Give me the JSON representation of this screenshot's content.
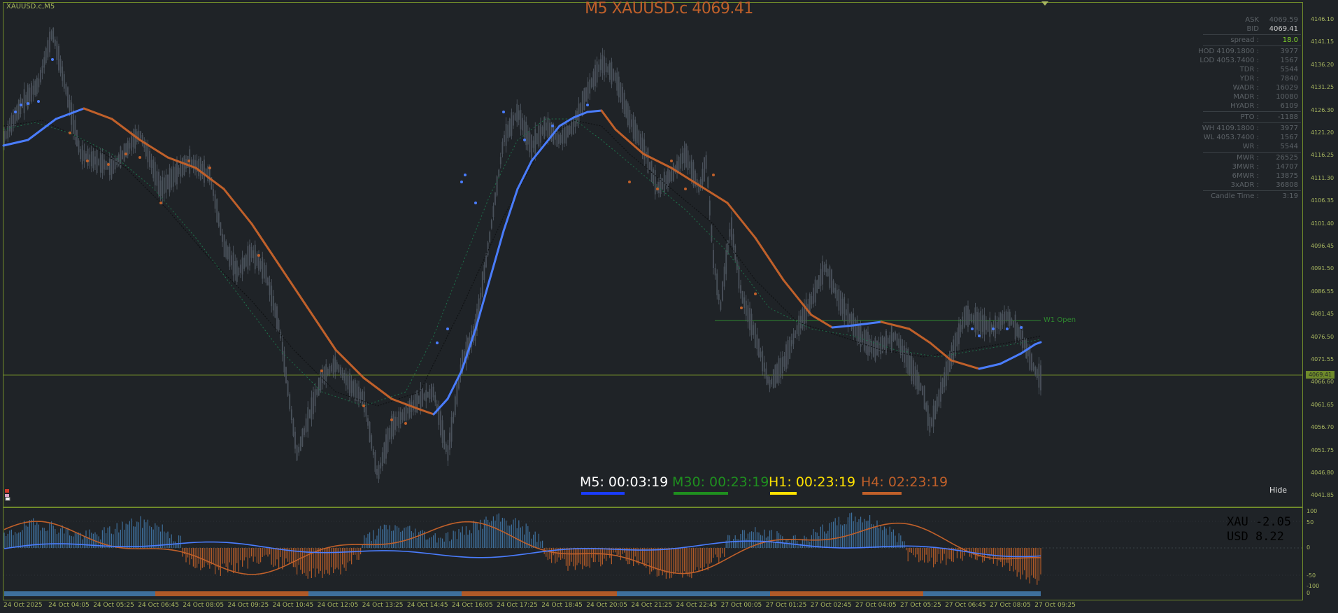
{
  "chart": {
    "symbol_label": "XAUUSD.c,M5",
    "title": "M5 XAUUSD.c 4069.41",
    "current_price_tag": "4069.41",
    "w1_open_label": "W1 Open",
    "hide_label": "Hide",
    "price_axis": [
      "4146.10",
      "4141.15",
      "4136.20",
      "4131.25",
      "4126.30",
      "4121.20",
      "4116.25",
      "4111.30",
      "4106.35",
      "4101.40",
      "4096.45",
      "4091.50",
      "4086.55",
      "4081.45",
      "4076.50",
      "4071.55",
      "4066.60",
      "4061.65",
      "4056.70",
      "4051.75",
      "4046.80",
      "4041.85"
    ],
    "time_axis": [
      "24 Oct 2025",
      "24 Oct 04:05",
      "24 Oct 05:25",
      "24 Oct 06:45",
      "24 Oct 08:05",
      "24 Oct 09:25",
      "24 Oct 10:45",
      "24 Oct 12:05",
      "24 Oct 13:25",
      "24 Oct 14:45",
      "24 Oct 16:05",
      "24 Oct 17:25",
      "24 Oct 18:45",
      "24 Oct 20:05",
      "24 Oct 21:25",
      "24 Oct 22:45",
      "27 Oct 00:05",
      "27 Oct 01:25",
      "27 Oct 02:45",
      "27 Oct 04:05",
      "27 Oct 05:25",
      "27 Oct 06:45",
      "27 Oct 08:05",
      "27 Oct 09:25"
    ],
    "sub_axis": [
      "100",
      "50",
      "0",
      "-50",
      "-100",
      "0"
    ]
  },
  "info_panel": {
    "rows": [
      {
        "k": "ASK",
        "v": "4069.59"
      },
      {
        "k": "BID",
        "v": "4069.41"
      },
      {
        "sep": true
      },
      {
        "k": "spread :",
        "v": "18.0",
        "green": true
      },
      {
        "sep": true
      },
      {
        "k": "HOD  4109.1800 :",
        "v": "3977"
      },
      {
        "k": "LOD  4053.7400 :",
        "v": "1567"
      },
      {
        "k": "TDR :",
        "v": "5544"
      },
      {
        "k": "YDR :",
        "v": "7840"
      },
      {
        "k": "WADR :",
        "v": "16029"
      },
      {
        "k": "MADR :",
        "v": "10080"
      },
      {
        "k": "HYADR :",
        "v": "6109"
      },
      {
        "sep": true
      },
      {
        "k": "PTO :",
        "v": "-1188"
      },
      {
        "sep": true
      },
      {
        "k": "WH  4109.1800 :",
        "v": "3977"
      },
      {
        "k": "WL  4053.7400 :",
        "v": "1567"
      },
      {
        "k": "WR :",
        "v": "5544"
      },
      {
        "sep": true
      },
      {
        "k": "MWR :",
        "v": "26525"
      },
      {
        "k": "3MWR :",
        "v": "14707"
      },
      {
        "k": "6MWR :",
        "v": "13875"
      },
      {
        "k": "3xADR :",
        "v": "36808"
      },
      {
        "sep": true
      },
      {
        "k": "Candle Time :",
        "v": "3:19"
      }
    ]
  },
  "timers": [
    {
      "label": "M5: 00:03:19",
      "color": "#ffffff",
      "bar": "#1a3cff"
    },
    {
      "label": "M30: 00:23:19",
      "color": "#1f8f1f",
      "bar": "#1f8f1f"
    },
    {
      "label": "H1: 00:23:19",
      "color": "#ffe100",
      "bar": "#ffe100"
    },
    {
      "label": "H4: 02:23:19",
      "color": "#c0602a",
      "bar": "#c0602a"
    }
  ],
  "currency_strength": {
    "xau": "XAU  -2.05",
    "usd": "USD  8.22",
    "xau_color": "#4a7dff",
    "usd_color": "#c0602a"
  }
}
